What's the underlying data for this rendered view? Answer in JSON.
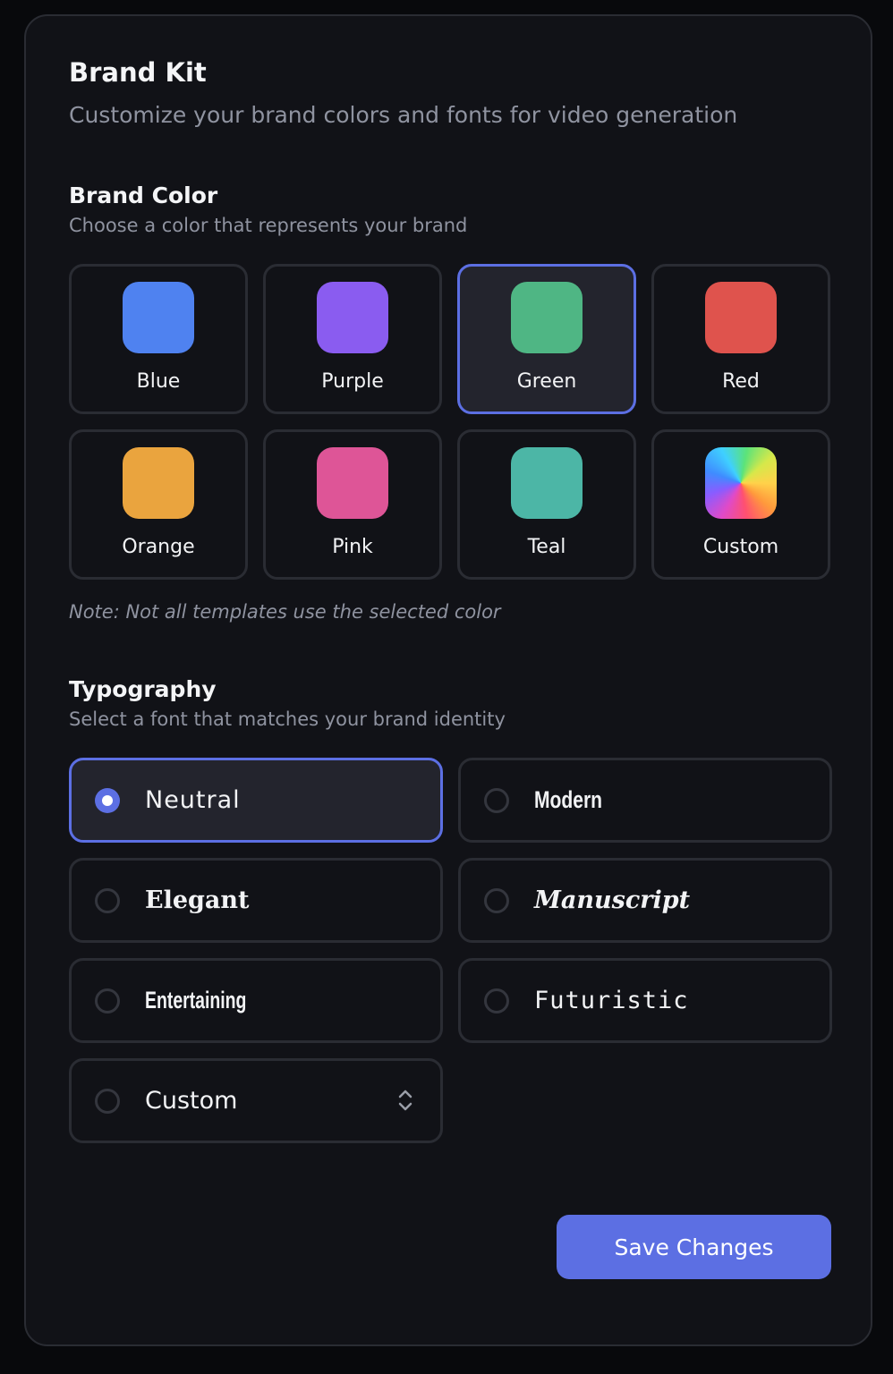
{
  "header": {
    "title": "Brand Kit",
    "subtitle": "Customize your brand colors and fonts for video generation"
  },
  "brand_color": {
    "title": "Brand Color",
    "subtitle": "Choose a color that represents your brand",
    "selected": "Green",
    "options": [
      {
        "label": "Blue",
        "color": "#4f82f0"
      },
      {
        "label": "Purple",
        "color": "#8a5cf0"
      },
      {
        "label": "Green",
        "color": "#4fb684"
      },
      {
        "label": "Red",
        "color": "#df534d"
      },
      {
        "label": "Orange",
        "color": "#eaa43e"
      },
      {
        "label": "Pink",
        "color": "#de5597"
      },
      {
        "label": "Teal",
        "color": "#4cb6a6"
      },
      {
        "label": "Custom",
        "color": "conic-gradient"
      }
    ],
    "note": "Note: Not all templates use the selected color"
  },
  "typography": {
    "title": "Typography",
    "subtitle": "Select a font that matches your brand identity",
    "selected": "Neutral",
    "options": [
      {
        "label": "Neutral"
      },
      {
        "label": "Modern"
      },
      {
        "label": "Elegant"
      },
      {
        "label": "Manuscript"
      },
      {
        "label": "Entertaining"
      },
      {
        "label": "Futuristic"
      },
      {
        "label": "Custom",
        "icon": "chevron-up-down-icon"
      }
    ]
  },
  "actions": {
    "save_label": "Save Changes"
  },
  "theme": {
    "accent": "#5c6fe3",
    "background": "#111217",
    "border": "#2a2c33"
  }
}
